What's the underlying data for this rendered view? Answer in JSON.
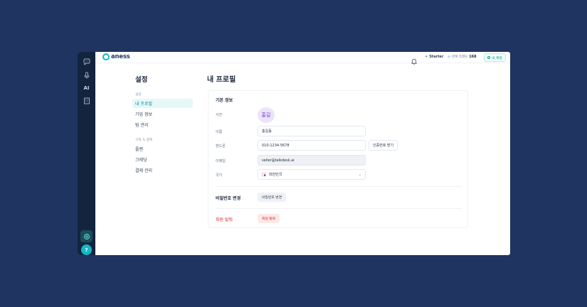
{
  "brand": {
    "name": "aness"
  },
  "header": {
    "plan_label": "Starter",
    "credit_label": "잔여 크레딧",
    "credit_value": "168",
    "account_label": "내 계정"
  },
  "rail": {
    "ai_label": "AI",
    "help_label": "?"
  },
  "settings_nav": {
    "title": "설정",
    "group1_label": "설정",
    "group1_items": [
      "내 프로필",
      "기업 정보",
      "팀 관리"
    ],
    "group2_label": "구독 & 결제",
    "group2_items": [
      "플랜",
      "크레딧",
      "결제 관리"
    ]
  },
  "profile": {
    "title": "내 프로필",
    "section_basic": "기본 정보",
    "photo_label": "사진",
    "avatar_text": "홍길",
    "name_label": "이름",
    "name_value": "홍길동",
    "phone_label": "핸드폰",
    "phone_value": "010-1234-5678",
    "verify_button": "인증번호 받기",
    "email_label": "이메일",
    "email_value": "seller@talkdesk.ai",
    "country_label": "국가",
    "country_value": "대한민국",
    "password_section": "비밀번호 변경",
    "password_button": "비밀번호 변경",
    "withdraw_section": "회원 탈퇴",
    "withdraw_button": "회원 탈퇴"
  },
  "colors": {
    "background": "#1f3460",
    "rail": "#13243f",
    "accent": "#14b8c6",
    "danger": "#dc2626"
  }
}
